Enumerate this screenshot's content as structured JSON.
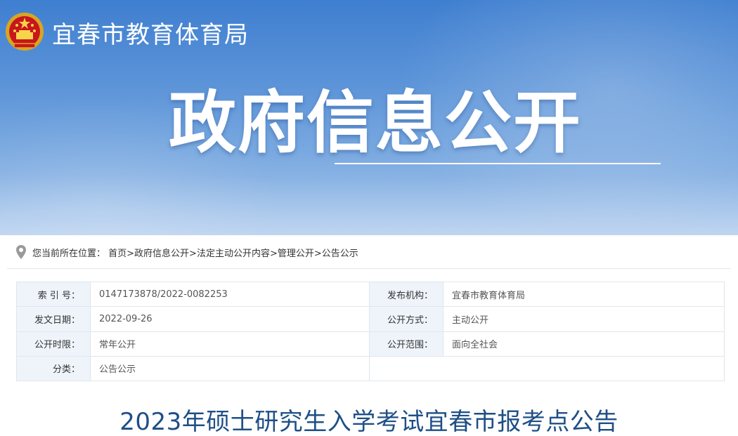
{
  "header": {
    "site_name": "宜春市教育体育局",
    "banner_title": "政府信息公开"
  },
  "breadcrumb": {
    "prefix": "您当前所在位置：",
    "path": "首页>政府信息公开>法定主动公开内容>管理公开>公告公示"
  },
  "info": {
    "index_no_label": "索 引 号：",
    "index_no": "0147173878/2022-0082253",
    "publisher_label": "发布机构：",
    "publisher": "宜春市教育体育局",
    "date_label": "发文日期：",
    "date": "2022-09-26",
    "mode_label": "公开方式：",
    "mode": "主动公开",
    "period_label": "公开时限：",
    "period": "常年公开",
    "scope_label": "公开范围：",
    "scope": "面向全社会",
    "category_label": "分类：",
    "category": "公告公示"
  },
  "article": {
    "title": "2023年硕士研究生入学考试宜春市报考点公告"
  },
  "colors": {
    "banner_blue": "#3f7fd0",
    "title_blue": "#1f4f86",
    "label_bg": "#eef4fa"
  },
  "icons": {
    "emblem": "national-emblem-icon",
    "location": "location-pin-icon"
  }
}
